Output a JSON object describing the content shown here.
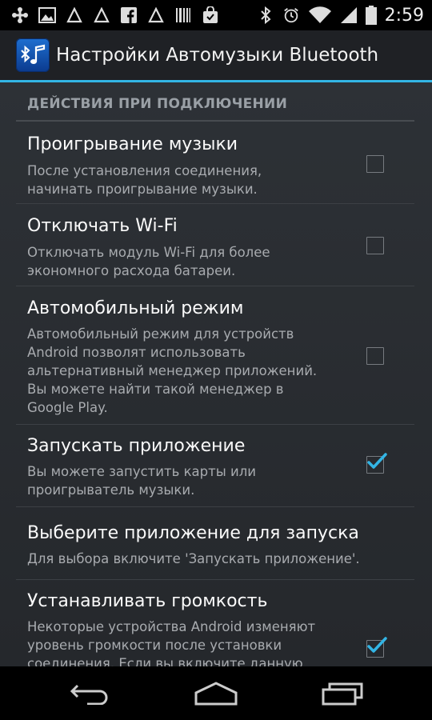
{
  "status_bar": {
    "time": "2:59",
    "notification_icons": [
      "usb-icon",
      "image-icon",
      "triangle-icon",
      "triangle-icon",
      "facebook-icon",
      "triangle-icon",
      "barcode-icon",
      "shopping-bag-icon"
    ],
    "system_icons": [
      "bluetooth-icon",
      "alarm-icon",
      "wifi-icon",
      "signal-icon",
      "battery-icon"
    ]
  },
  "action_bar": {
    "title": "Настройки Автомузыки Bluetooth",
    "app_icon": "bluetooth-music-icon"
  },
  "category": {
    "label": "ДЕЙСТВИЯ ПРИ ПОДКЛЮЧЕНИИ"
  },
  "preferences": [
    {
      "title": "Проигрывание музыки",
      "summary_lines": [
        "После установления соединения,",
        "начинать проигрывание музыки."
      ],
      "checked": false
    },
    {
      "title": "Отключать Wi-Fi",
      "summary_lines": [
        "Отключать модуль Wi-Fi для более",
        "экономного расхода батареи."
      ],
      "checked": false
    },
    {
      "title": "Автомобильный режим",
      "summary_lines": [
        "Автомобильный режим для устройств",
        "Android позволят использовать",
        "альтернативный менеджер приложений.",
        "Вы можете найти такой менеджер в",
        "Google Play."
      ],
      "checked": false
    },
    {
      "title": "Запускать приложение",
      "summary_lines": [
        "Вы можете запустить карты или",
        "проигрыватель музыки."
      ],
      "checked": true
    },
    {
      "title": "Выберите приложение для запуска",
      "summary_lines": [
        "Для выбора включите 'Запускать приложение'."
      ]
    },
    {
      "title": "Устанавливать громкость",
      "summary_lines": [
        "Некоторые устройства Android изменяют",
        "уровень громкости после установки",
        "соединения. Если вы включите данную"
      ],
      "checked": true
    }
  ],
  "colors": {
    "accent": "#33b5e5",
    "action_bar": "#1f2125",
    "content_bg": "#2d3136"
  },
  "nav_bar": {
    "icons": [
      "back-icon",
      "home-icon",
      "recent-apps-icon"
    ]
  }
}
